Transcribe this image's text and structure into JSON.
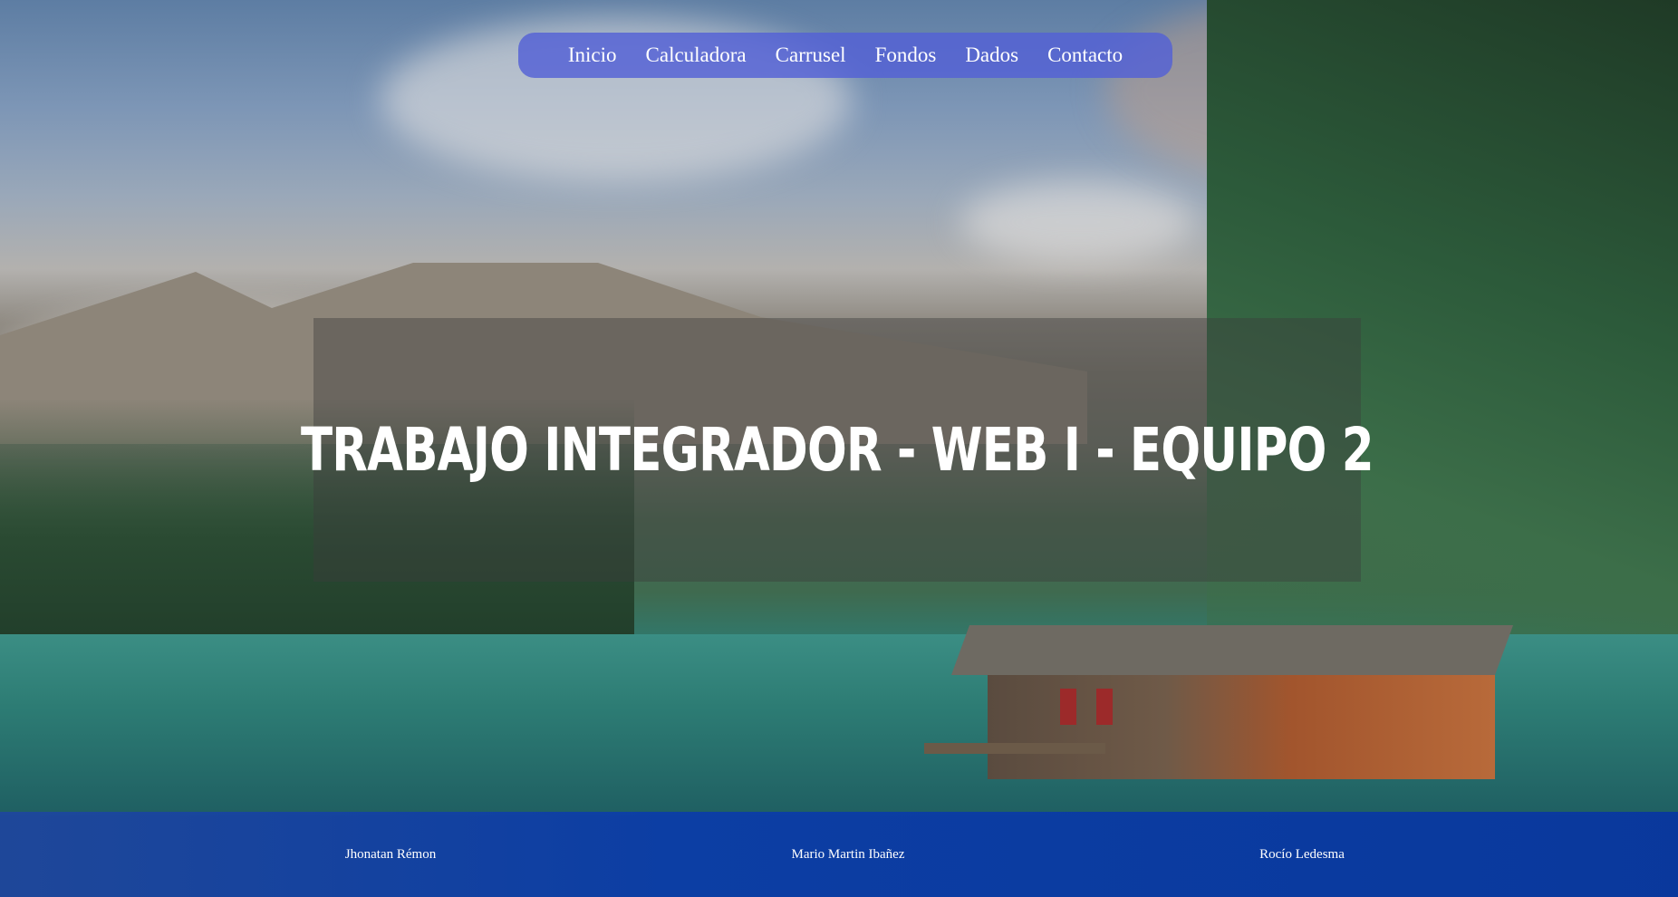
{
  "nav": {
    "items": [
      {
        "label": "Inicio"
      },
      {
        "label": "Calculadora"
      },
      {
        "label": "Carrusel"
      },
      {
        "label": "Fondos"
      },
      {
        "label": "Dados"
      },
      {
        "label": "Contacto"
      }
    ]
  },
  "hero": {
    "title": "Trabajo Integrador - Web I - Equipo 2"
  },
  "footer": {
    "members": [
      {
        "name": "Jhonatan Rémon"
      },
      {
        "name": "Mario Martin Ibañez"
      },
      {
        "name": "Rocío Ledesma"
      }
    ]
  },
  "colors": {
    "nav_bg": "#5360d6",
    "footer_bg": "#0a3caa"
  },
  "background": {
    "image": "mountain-lake-landscape"
  }
}
